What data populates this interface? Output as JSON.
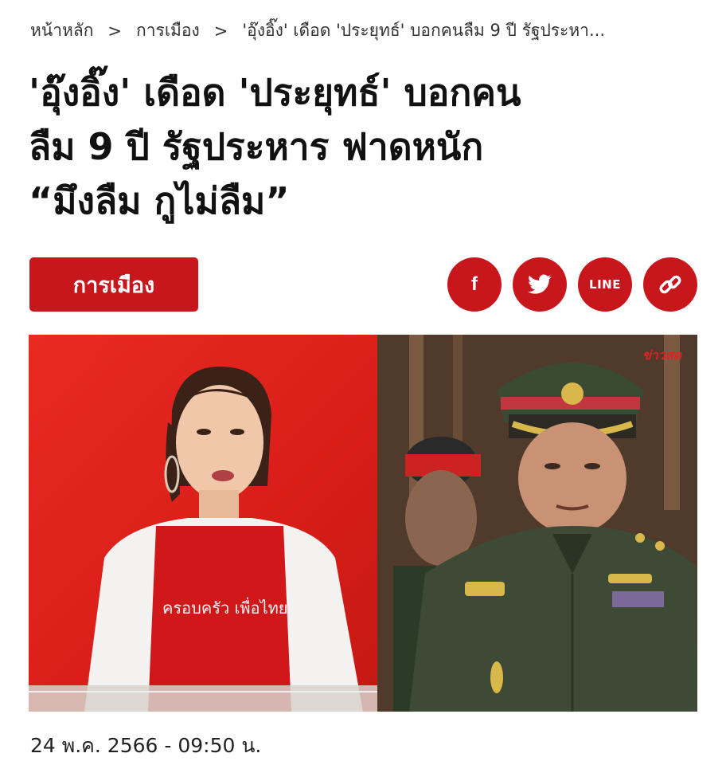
{
  "breadcrumb": {
    "home": "หน้าหลัก",
    "category": "การเมือง",
    "current": "'อุ๊งอิ๊ง' เดือด 'ประยุทธ์' บอกคนลืม 9 ปี รัฐประหา...",
    "separator": ">"
  },
  "article": {
    "headline_line1": "'อุ๊งอิ๊ง' เดือด 'ประยุทธ์' บอกคน",
    "headline_line2": "ลืม 9 ปี รัฐประหาร ฟาดหนัก",
    "headline_line3": "“มึงลืม กูไม่ลืม”",
    "category": "การเมือง",
    "timestamp": "24 พ.ค. 2566 - 09:50 น.",
    "photo_watermark": "ข่าวสด",
    "shirt_text": "ครอบครัว เพื่อไทย"
  },
  "share": {
    "facebook_label": "f",
    "line_label": "LINE"
  },
  "colors": {
    "accent": "#c8161d",
    "text": "#111111"
  },
  "icons": [
    "facebook-icon",
    "twitter-icon",
    "line-icon",
    "link-icon"
  ]
}
